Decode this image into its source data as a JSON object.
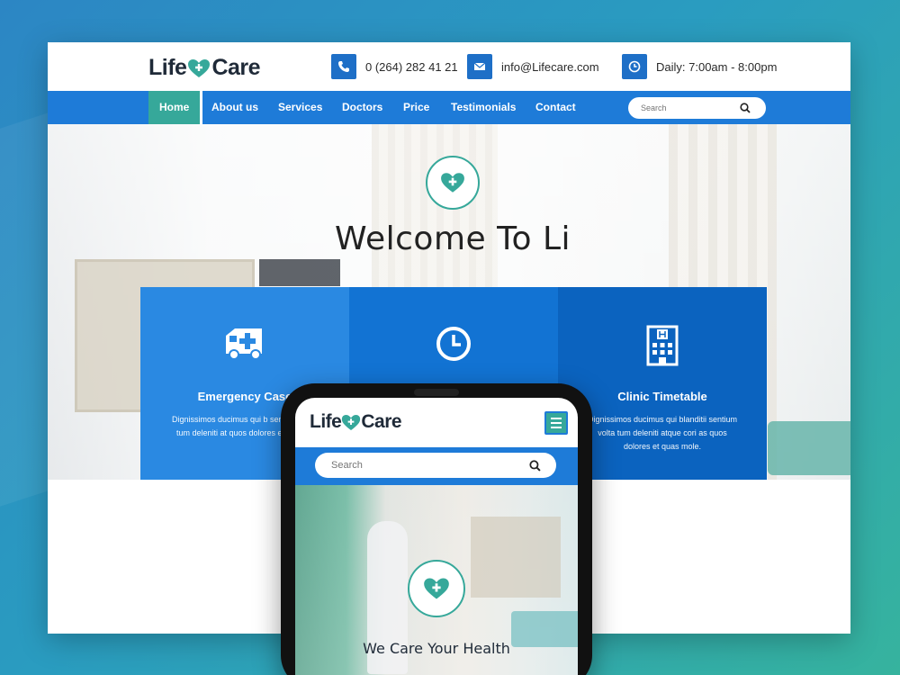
{
  "brand": {
    "name_part1": "Life",
    "name_part2": "Care",
    "accent_color": "#1e7bd8",
    "secondary_color": "#36a89a"
  },
  "contact": {
    "phone": "0 (264) 282 41 21",
    "email": "info@Lifecare.com",
    "hours": "Daily: 7:00am - 8:00pm",
    "phone_icon": "phone-icon",
    "email_icon": "envelope-icon",
    "hours_icon": "clock-icon"
  },
  "nav": {
    "items": [
      {
        "label": "Home",
        "active": true
      },
      {
        "label": "About us"
      },
      {
        "label": "Services"
      },
      {
        "label": "Doctors"
      },
      {
        "label": "Price"
      },
      {
        "label": "Testimonials"
      },
      {
        "label": "Contact"
      }
    ],
    "search_placeholder": "Search"
  },
  "hero": {
    "title": "Welcome To Li",
    "icon": "heart-plus-icon"
  },
  "features": [
    {
      "title": "Emergency Case",
      "icon": "ambulance-icon",
      "text": "Dignissimos ducimus qui b sentium volta tum deleniti at quos dolores et quas m"
    },
    {
      "title": "",
      "icon": "clock-icon",
      "text": ""
    },
    {
      "title": "Clinic Timetable",
      "icon": "hospital-icon",
      "text": "Dignissimos ducimus qui blanditii sentium volta tum deleniti atque cori as quos dolores et quas mole."
    }
  ],
  "mobile": {
    "search_placeholder": "Search",
    "hero_title": "We Care Your Health",
    "menu_icon": "hamburger-menu-icon"
  }
}
